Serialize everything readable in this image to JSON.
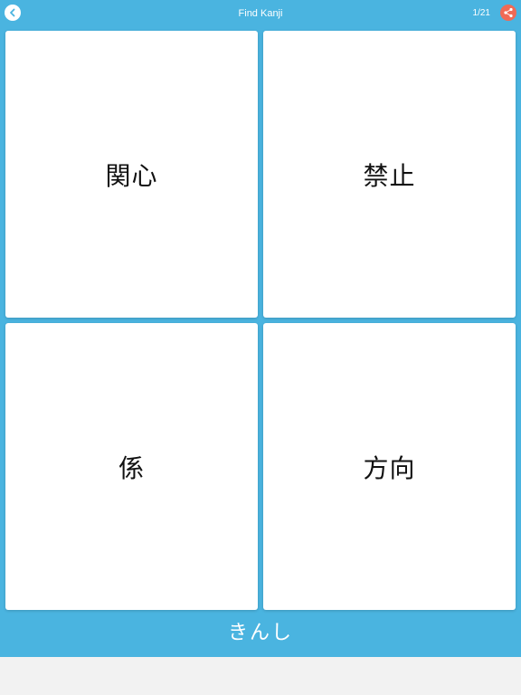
{
  "header": {
    "title": "Find Kanji",
    "progress": "1/21",
    "back_icon": "chevron-left-icon",
    "share_icon": "share-icon",
    "accent_color": "#4ab4e0",
    "share_color": "#f06a55"
  },
  "choices": [
    {
      "kanji": "関心"
    },
    {
      "kanji": "禁止"
    },
    {
      "kanji": "係"
    },
    {
      "kanji": "方向"
    }
  ],
  "prompt": {
    "reading": "きんし"
  }
}
